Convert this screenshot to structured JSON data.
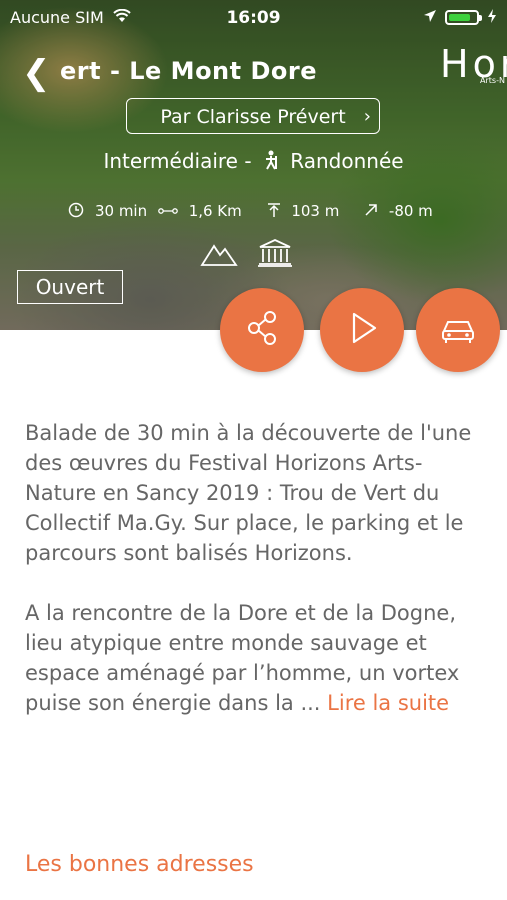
{
  "status_bar": {
    "carrier": "Aucune SIM",
    "time": "16:09",
    "battery_level": 0.7,
    "battery_color": "#3dd13d"
  },
  "nav": {
    "title": "ert - Le Mont Dore",
    "brand": "Hor",
    "brand_sub": "Arts-N"
  },
  "author": {
    "label": "Par  Clarisse Prévert"
  },
  "meta": {
    "level": "Intermédiaire -",
    "activity": "Randonnée"
  },
  "stats": {
    "duration": "30 min",
    "distance": "1,6 Km",
    "elevation_gain": "103 m",
    "elevation_loss": "-80 m"
  },
  "status_badge": "Ouvert",
  "description": {
    "paragraph1": "Balade de 30 min à la découverte de l'une des œuvres du Festival Horizons Arts-Nature en Sancy 2019 : Trou de Vert du Collectif Ma.Gy. Sur place, le parking et le parcours sont balisés Horizons.",
    "paragraph2": "A la rencontre de la Dore et de la Dogne, lieu atypique entre monde sauvage et espace aménagé par l’homme, un vortex puise son énergie dans la  ... ",
    "read_more": "Lire la suite"
  },
  "sections": {
    "good_addresses": "Les bonnes adresses"
  },
  "colors": {
    "accent": "#ea7444",
    "text": "#666666"
  },
  "icons": {
    "share": "share-icon",
    "play": "play-icon",
    "car": "car-icon",
    "mountain": "mountain-icon",
    "monument": "monument-icon"
  }
}
